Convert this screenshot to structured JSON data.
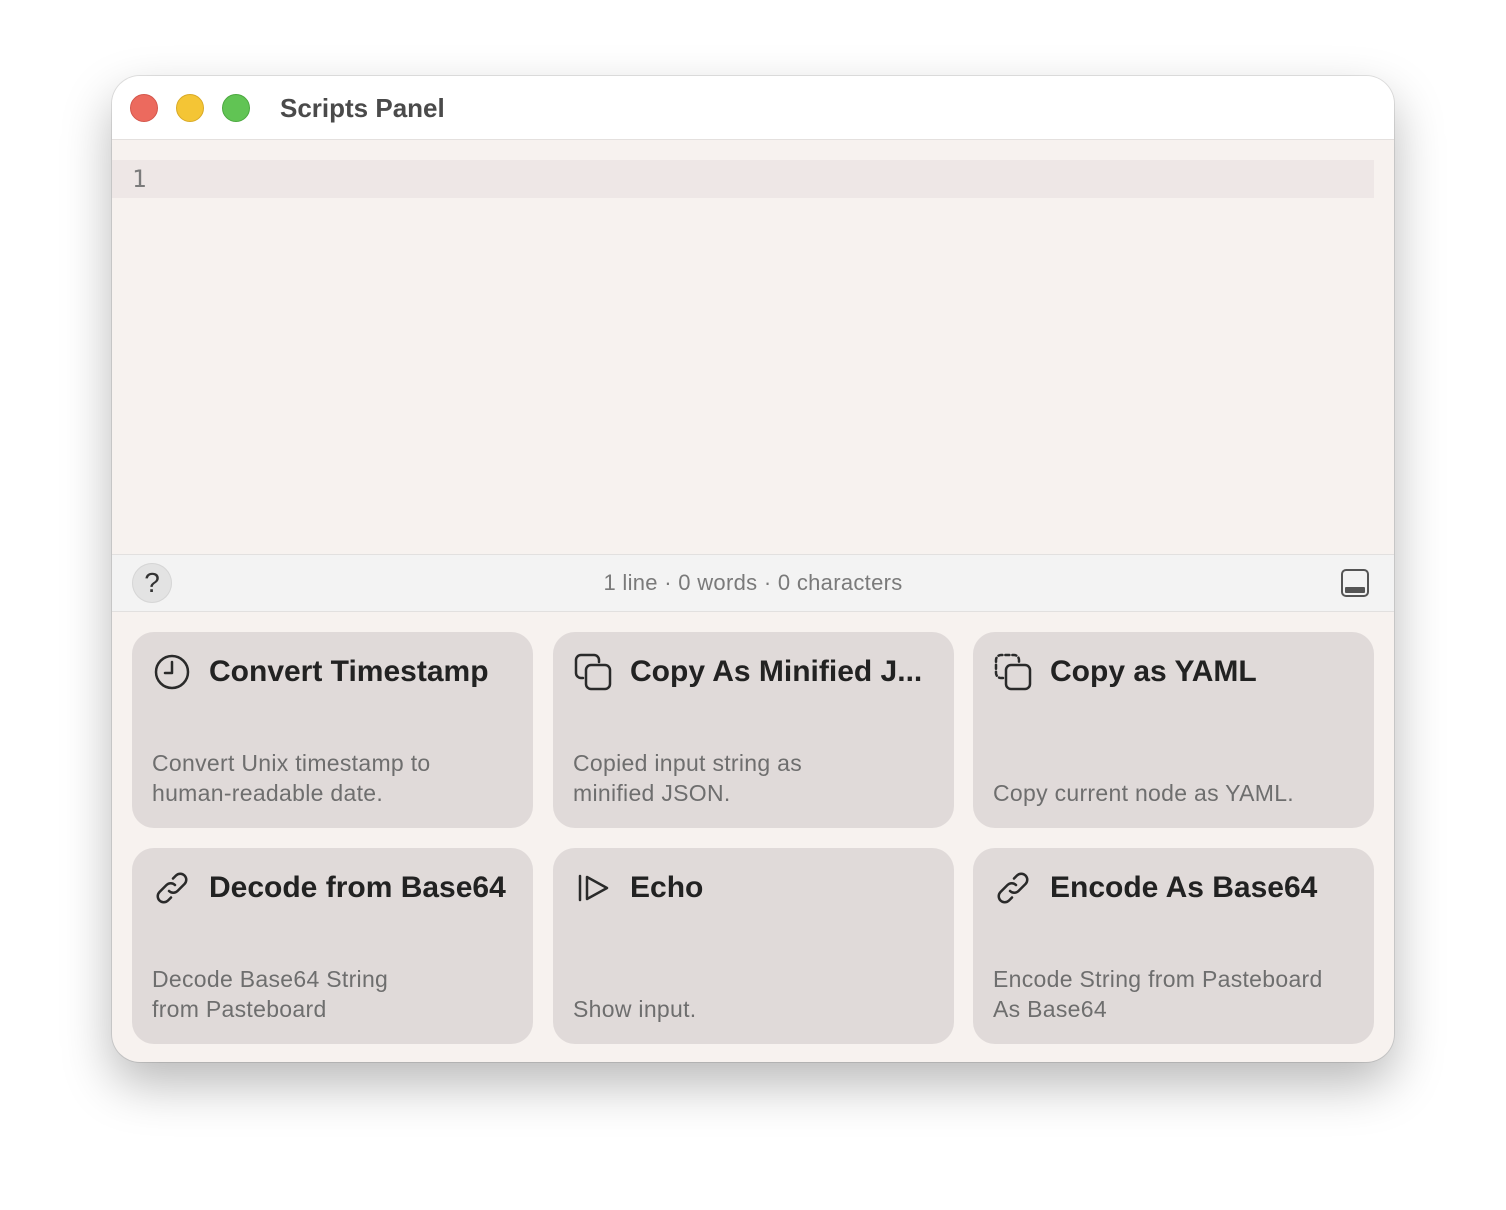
{
  "window": {
    "title": "Scripts Panel"
  },
  "editor": {
    "line_number": "1",
    "content": ""
  },
  "statusbar": {
    "help_label": "?",
    "stats": "1 line · 0 words · 0 characters"
  },
  "scripts": [
    {
      "title": "Convert Timestamp",
      "description": "Convert Unix timestamp to\nhuman-readable date.",
      "icon": "clock-icon"
    },
    {
      "title": "Copy As Minified J...",
      "description": "Copied input string as\nminified JSON.",
      "icon": "copy-icon"
    },
    {
      "title": "Copy as YAML",
      "description": "Copy current node as YAML.",
      "icon": "copy-dashed-icon"
    },
    {
      "title": "Decode from Base64",
      "description": "Decode Base64 String\nfrom Pasteboard",
      "icon": "link-icon"
    },
    {
      "title": "Echo",
      "description": "Show input.",
      "icon": "play-icon"
    },
    {
      "title": "Encode As Base64",
      "description": "Encode String from Pasteboard\nAs Base64",
      "icon": "link-icon"
    }
  ],
  "colors": {
    "close": "#ec6a5e",
    "minimize": "#f4c535",
    "maximize": "#61c454",
    "card_bg": "#e0dad9",
    "editor_bg": "#f7f2ef"
  }
}
